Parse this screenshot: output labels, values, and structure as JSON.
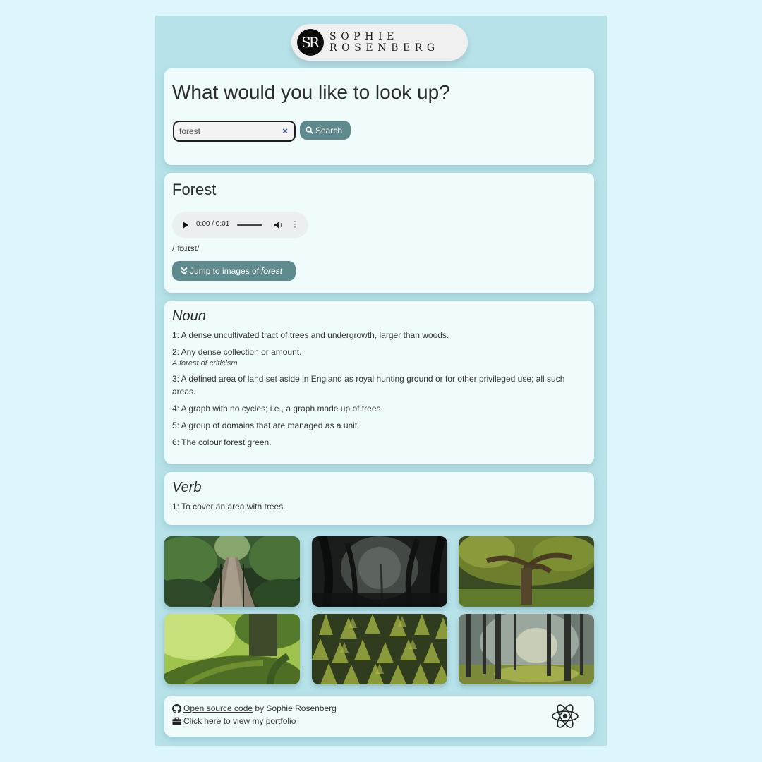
{
  "logo": {
    "monogram": "SR",
    "line1": "SOPHIE",
    "line2": "ROSENBERG"
  },
  "search": {
    "title": "What would you like to look up?",
    "value": "forest",
    "clear_label": "×",
    "button_label": "Search"
  },
  "word": {
    "title": "Forest",
    "audio_time": "0:00 / 0:01",
    "phonetic": "/ˈfɒɹɪst/",
    "jump_prefix": "Jump to images of",
    "jump_word": "forest"
  },
  "meanings": [
    {
      "part_of_speech": "Noun",
      "definitions": [
        {
          "text": "1: A dense uncultivated tract of trees and undergrowth, larger than woods."
        },
        {
          "text": "2: Any dense collection or amount.",
          "example": "A forest of criticism"
        },
        {
          "text": "3: A defined area of land set aside in England as royal hunting ground or for other privileged use; all such areas."
        },
        {
          "text": "4: A graph with no cycles; i.e., a graph made up of trees."
        },
        {
          "text": "5: A group of domains that are managed as a unit."
        },
        {
          "text": "6: The colour forest green."
        }
      ]
    },
    {
      "part_of_speech": "Verb",
      "definitions": [
        {
          "text": "1: To cover an area with trees."
        }
      ]
    }
  ],
  "images": [
    "forest-bridge-photo",
    "dark-forest-photo",
    "old-tree-photo",
    "mossy-roots-photo",
    "pine-canopy-photo",
    "sunlit-forest-photo"
  ],
  "footer": {
    "source_link": "Open source code",
    "source_suffix": " by Sophie Rosenberg",
    "portfolio_link": "Click here",
    "portfolio_suffix": " to view my portfolio"
  },
  "colors": {
    "page_bg": "#ddf5fc",
    "app_bg": "#b7e2e9",
    "card_bg": "#effcfb",
    "button": "#5e8a8e"
  }
}
